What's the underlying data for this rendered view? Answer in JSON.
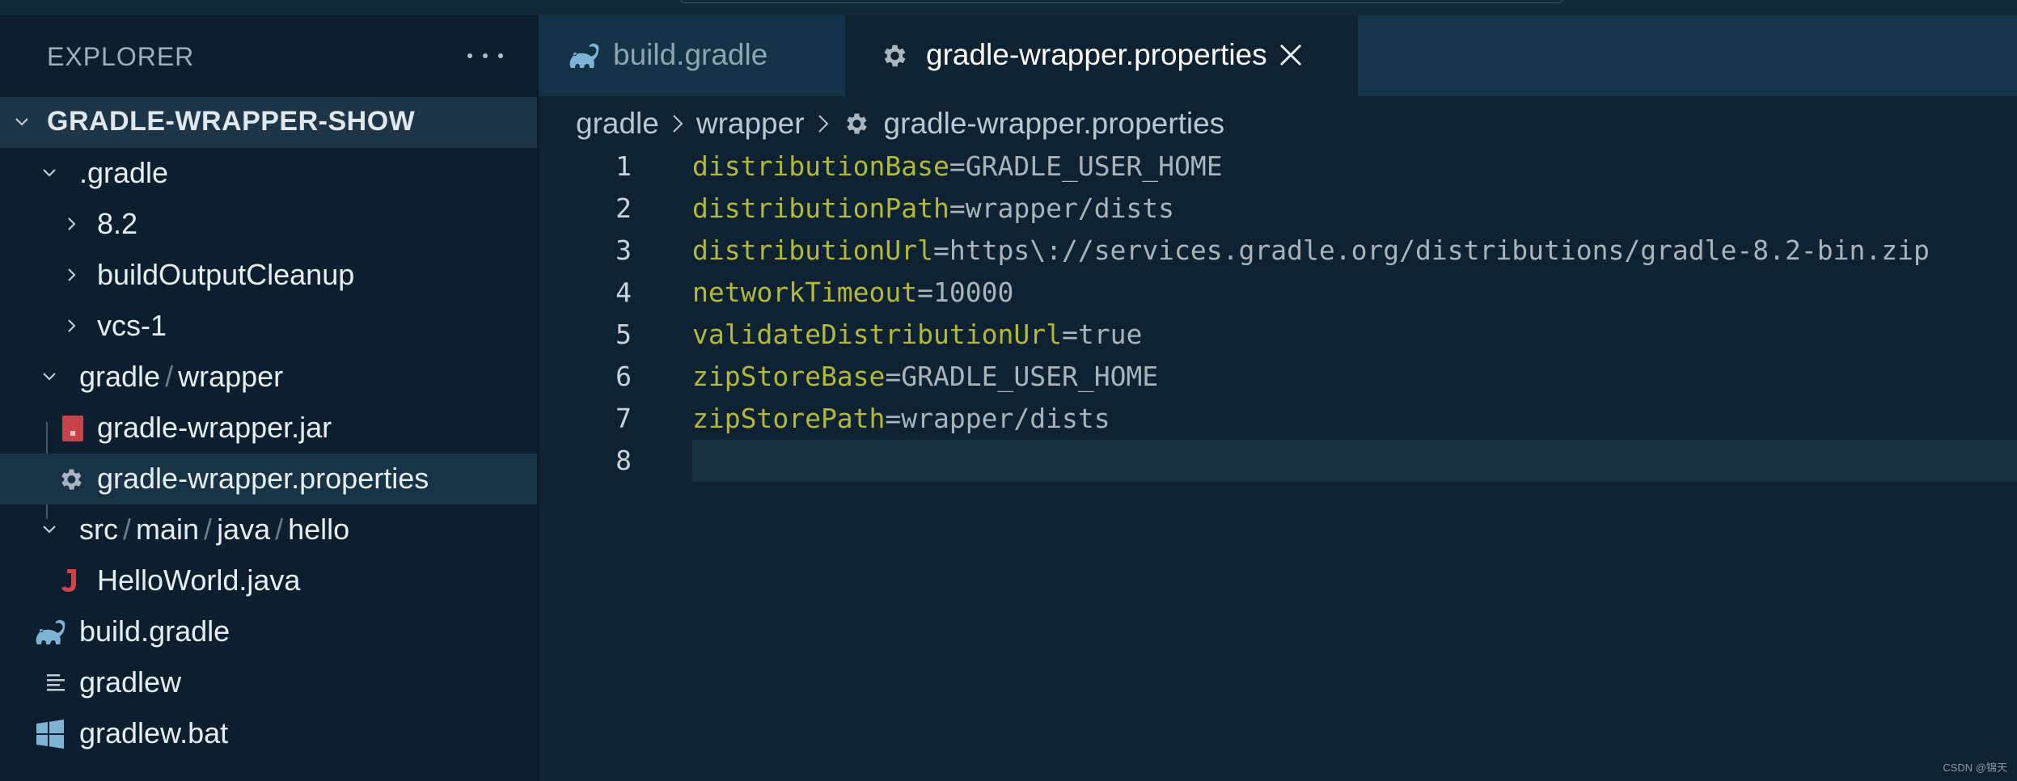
{
  "sidebar": {
    "title": "EXPLORER",
    "more_icon": "ellipsis-icon",
    "project": "GRADLE-WRAPPER-SHOW",
    "items": [
      {
        "name": ".gradle",
        "icon": "chevron-down-icon"
      },
      {
        "name": "8.2",
        "icon": "chevron-right-icon"
      },
      {
        "name": "buildOutputCleanup",
        "icon": "chevron-right-icon"
      },
      {
        "name": "vcs-1",
        "icon": "chevron-right-icon"
      },
      {
        "segments": [
          "gradle",
          "wrapper"
        ],
        "icon": "chevron-down-icon"
      },
      {
        "name": "gradle-wrapper.jar",
        "icon": "jar-icon"
      },
      {
        "name": "gradle-wrapper.properties",
        "icon": "gear-icon"
      },
      {
        "segments": [
          "src",
          "main",
          "java",
          "hello"
        ],
        "icon": "chevron-down-icon"
      },
      {
        "name": "HelloWorld.java",
        "icon": "java-icon"
      },
      {
        "name": "build.gradle",
        "icon": "gradle-elephant-icon"
      },
      {
        "name": "gradlew",
        "icon": "text-file-icon"
      },
      {
        "name": "gradlew.bat",
        "icon": "windows-icon"
      }
    ]
  },
  "tabs": [
    {
      "label": "build.gradle",
      "icon": "gradle-elephant-icon",
      "active": false
    },
    {
      "label": "gradle-wrapper.properties",
      "icon": "gear-icon",
      "active": true
    }
  ],
  "breadcrumb": [
    "gradle",
    "wrapper",
    "gradle-wrapper.properties"
  ],
  "editor": {
    "lines": [
      {
        "num": "1",
        "key": "distributionBase",
        "value": "=GRADLE_USER_HOME"
      },
      {
        "num": "2",
        "key": "distributionPath",
        "value": "=wrapper/dists"
      },
      {
        "num": "3",
        "key": "distributionUrl",
        "value": "=https\\://services.gradle.org/distributions/gradle-8.2-bin.zip"
      },
      {
        "num": "4",
        "key": "networkTimeout",
        "value": "=10000"
      },
      {
        "num": "5",
        "key": "validateDistributionUrl",
        "value": "=true"
      },
      {
        "num": "6",
        "key": "zipStoreBase",
        "value": "=GRADLE_USER_HOME"
      },
      {
        "num": "7",
        "key": "zipStorePath",
        "value": "=wrapper/dists"
      },
      {
        "num": "8",
        "key": "",
        "value": ""
      }
    ],
    "current_line": 8
  },
  "watermark": "CSDN @锦天",
  "colors": {
    "background": "#0e2231",
    "sidebar": "#0d1f2e",
    "key": "#b3b934",
    "value": "#a8b3ba"
  }
}
